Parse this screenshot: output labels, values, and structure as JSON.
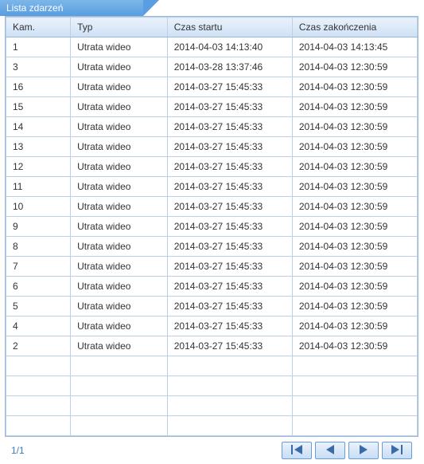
{
  "panel": {
    "title": "Lista zdarzeń"
  },
  "table": {
    "headers": {
      "cam": "Kam.",
      "type": "Typ",
      "start": "Czas startu",
      "end": "Czas zakończenia"
    },
    "rows": [
      {
        "cam": "1",
        "type": "Utrata wideo",
        "start": "2014-04-03 14:13:40",
        "end": "2014-04-03 14:13:45"
      },
      {
        "cam": "3",
        "type": "Utrata wideo",
        "start": "2014-03-28 13:37:46",
        "end": "2014-04-03 12:30:59"
      },
      {
        "cam": "16",
        "type": "Utrata wideo",
        "start": "2014-03-27 15:45:33",
        "end": "2014-04-03 12:30:59"
      },
      {
        "cam": "15",
        "type": "Utrata wideo",
        "start": "2014-03-27 15:45:33",
        "end": "2014-04-03 12:30:59"
      },
      {
        "cam": "14",
        "type": "Utrata wideo",
        "start": "2014-03-27 15:45:33",
        "end": "2014-04-03 12:30:59"
      },
      {
        "cam": "13",
        "type": "Utrata wideo",
        "start": "2014-03-27 15:45:33",
        "end": "2014-04-03 12:30:59"
      },
      {
        "cam": "12",
        "type": "Utrata wideo",
        "start": "2014-03-27 15:45:33",
        "end": "2014-04-03 12:30:59"
      },
      {
        "cam": "11",
        "type": "Utrata wideo",
        "start": "2014-03-27 15:45:33",
        "end": "2014-04-03 12:30:59"
      },
      {
        "cam": "10",
        "type": "Utrata wideo",
        "start": "2014-03-27 15:45:33",
        "end": "2014-04-03 12:30:59"
      },
      {
        "cam": "9",
        "type": "Utrata wideo",
        "start": "2014-03-27 15:45:33",
        "end": "2014-04-03 12:30:59"
      },
      {
        "cam": "8",
        "type": "Utrata wideo",
        "start": "2014-03-27 15:45:33",
        "end": "2014-04-03 12:30:59"
      },
      {
        "cam": "7",
        "type": "Utrata wideo",
        "start": "2014-03-27 15:45:33",
        "end": "2014-04-03 12:30:59"
      },
      {
        "cam": "6",
        "type": "Utrata wideo",
        "start": "2014-03-27 15:45:33",
        "end": "2014-04-03 12:30:59"
      },
      {
        "cam": "5",
        "type": "Utrata wideo",
        "start": "2014-03-27 15:45:33",
        "end": "2014-04-03 12:30:59"
      },
      {
        "cam": "4",
        "type": "Utrata wideo",
        "start": "2014-03-27 15:45:33",
        "end": "2014-04-03 12:30:59"
      },
      {
        "cam": "2",
        "type": "Utrata wideo",
        "start": "2014-03-27 15:45:33",
        "end": "2014-04-03 12:30:59"
      }
    ],
    "empty_rows": 4
  },
  "pagination": {
    "info": "1/1"
  }
}
